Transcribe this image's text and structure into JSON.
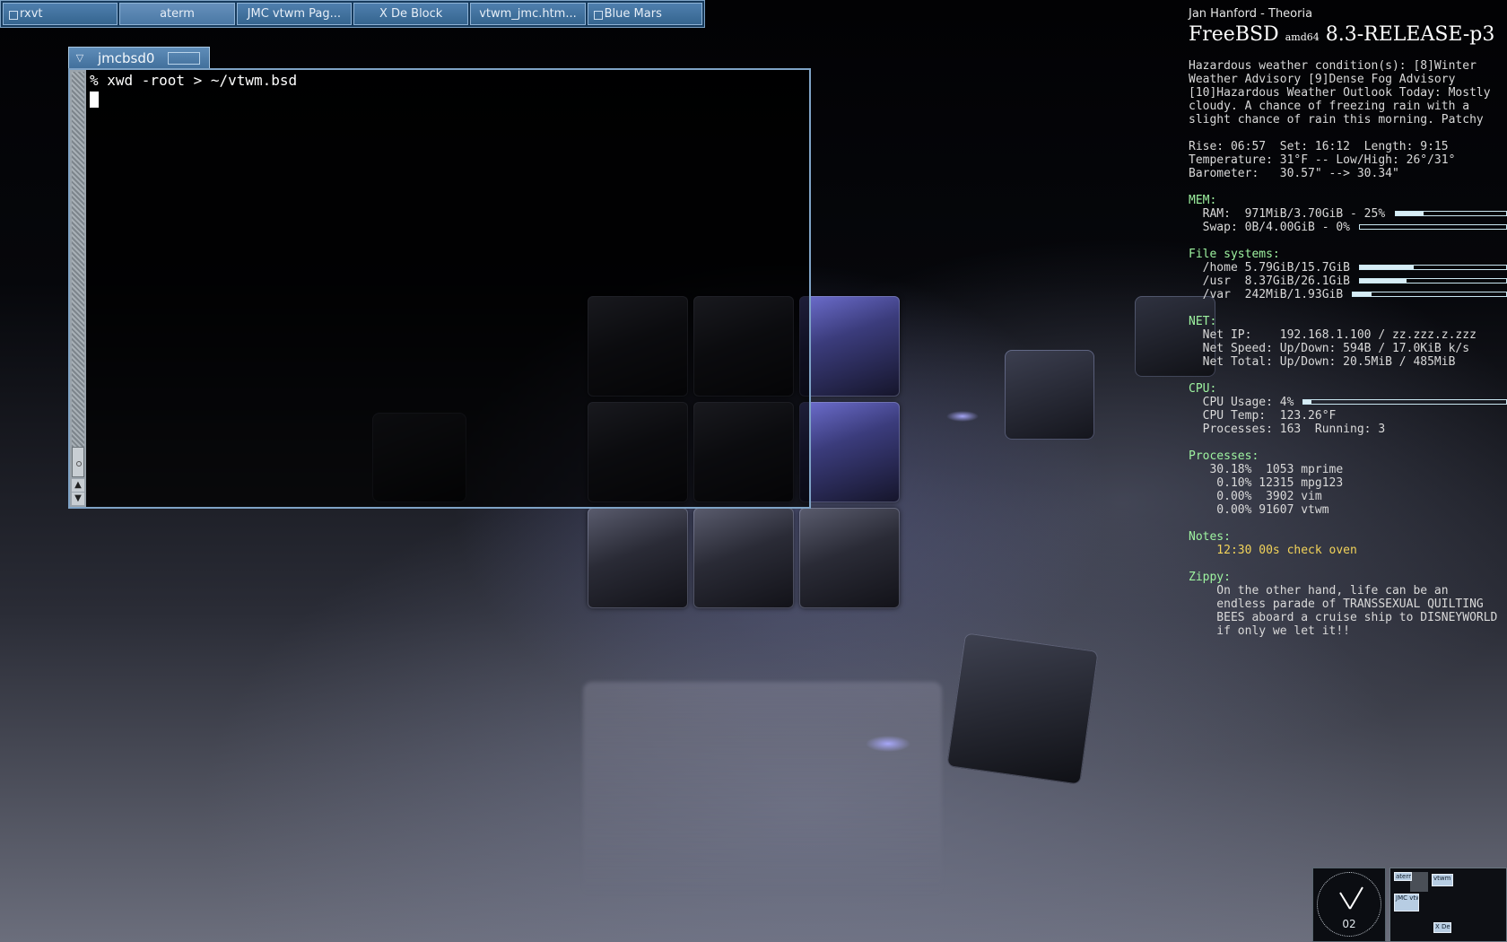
{
  "taskbar": {
    "items": [
      {
        "label": "rxvt",
        "active": false
      },
      {
        "label": "aterm",
        "active": true
      },
      {
        "label": "JMC vtwm Pag...",
        "active": false
      },
      {
        "label": "X De Block",
        "active": false
      },
      {
        "label": "vtwm_jmc.htm...",
        "active": false
      },
      {
        "label": "Blue Mars",
        "active": false
      }
    ]
  },
  "terminal": {
    "title": "jmcbsd0",
    "lines": [
      "% xwd -root > ~/vtwm.bsd"
    ]
  },
  "conky": {
    "now_playing": "Jan Hanford - Theoria",
    "os_name": "FreeBSD",
    "arch": "amd64",
    "release": "8.3-RELEASE-p3",
    "weather_lines": [
      "Hazardous weather condition(s): [8]Winter",
      "Weather Advisory [9]Dense Fog Advisory",
      "[10]Hazardous Weather Outlook Today: Mostly",
      "cloudy. A chance of freezing rain with a",
      "slight chance of rain this morning. Patchy"
    ],
    "sun_line": "Rise: 06:57  Set: 16:12  Length: 9:15",
    "temp_line": "Temperature: 31°F -- Low/High: 26°/31°",
    "baro_line": "Barometer:   30.57\" --> 30.34\"",
    "mem": {
      "header": "MEM:",
      "ram": "  RAM:  971MiB/3.70GiB - 25%",
      "ram_pct": 25,
      "swap": "  Swap: 0B/4.00GiB - 0%",
      "swap_pct": 0
    },
    "fs": {
      "header": "File systems:",
      "rows": [
        {
          "text": "  /home 5.79GiB/15.7GiB",
          "pct": 37
        },
        {
          "text": "  /usr  8.37GiB/26.1GiB",
          "pct": 32
        },
        {
          "text": "  /var  242MiB/1.93GiB",
          "pct": 12
        }
      ]
    },
    "net": {
      "header": "NET:",
      "ip": "  Net IP:    192.168.1.100 / zz.zzz.z.zzz",
      "speed": "  Net Speed: Up/Down: 594B / 17.0KiB k/s",
      "total": "  Net Total: Up/Down: 20.5MiB / 485MiB"
    },
    "cpu": {
      "header": "CPU:",
      "usage": "  CPU Usage: 4%",
      "usage_pct": 4,
      "temp": "  CPU Temp:  123.26°F",
      "procs": "  Processes: 163  Running: 3"
    },
    "processes": {
      "header": "Processes:",
      "rows": [
        "   30.18%  1053 mprime",
        "    0.10% 12315 mpg123",
        "    0.00%  3902 vim",
        "    0.00% 91607 vtwm"
      ]
    },
    "notes": {
      "header": "Notes:",
      "text": "    12:30 00s check oven"
    },
    "zippy": {
      "header": "Zippy:",
      "lines": [
        "    On the other hand, life can be an",
        "    endless parade of TRANSSEXUAL QUILTING",
        "    BEES aboard a cruise ship to DISNEYWORLD",
        "    if only we let it!!"
      ]
    }
  },
  "clock": {
    "date": "02"
  },
  "pager": {
    "windows": [
      "aterm",
      "vtwm",
      "JMC vtw",
      "X De"
    ]
  },
  "colors": {
    "section": "#9ef3a0",
    "note": "#f2d35a",
    "window_frame": "#7fa3c6",
    "taskbar": "#163a5c"
  }
}
